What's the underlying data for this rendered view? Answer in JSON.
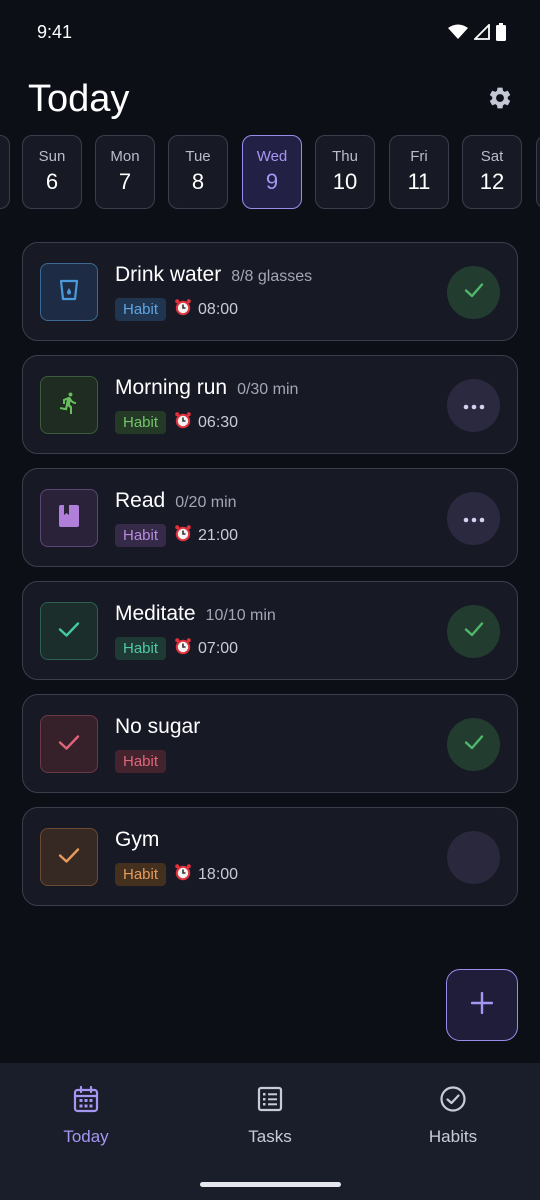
{
  "status_bar": {
    "time": "9:41"
  },
  "header": {
    "title": "Today"
  },
  "days": [
    {
      "name": "Sun",
      "num": "6"
    },
    {
      "name": "Mon",
      "num": "7"
    },
    {
      "name": "Tue",
      "num": "8"
    },
    {
      "name": "Wed",
      "num": "9"
    },
    {
      "name": "Thu",
      "num": "10"
    },
    {
      "name": "Fri",
      "num": "11"
    },
    {
      "name": "Sat",
      "num": "12"
    }
  ],
  "selected_day": "Wed",
  "habits": [
    {
      "title": "Drink water",
      "progress": "8/8 glasses",
      "badge": "Habit",
      "time": "08:00",
      "icon": "water-glass-icon",
      "accent": "#4b9ad9",
      "status": "done"
    },
    {
      "title": "Morning run",
      "progress": "0/30 min",
      "badge": "Habit",
      "time": "06:30",
      "icon": "running-person-icon",
      "accent": "#69bd5e",
      "status": "pending"
    },
    {
      "title": "Read",
      "progress": "0/20 min",
      "badge": "Habit",
      "time": "21:00",
      "icon": "book-icon",
      "accent": "#b07fd9",
      "status": "pending"
    },
    {
      "title": "Meditate",
      "progress": "10/10 min",
      "badge": "Habit",
      "time": "07:00",
      "icon": "checkmark-icon",
      "accent": "#45c9a0",
      "status": "done"
    },
    {
      "title": "No sugar",
      "progress": "",
      "badge": "Habit",
      "time": "",
      "icon": "checkmark-icon",
      "accent": "#e0657a",
      "status": "done"
    },
    {
      "title": "Gym",
      "progress": "",
      "badge": "Habit",
      "time": "18:00",
      "icon": "checkmark-icon",
      "accent": "#e79a5c",
      "status": "empty"
    }
  ],
  "nav": {
    "today": "Today",
    "tasks": "Tasks",
    "habits": "Habits"
  },
  "colors": {
    "accent": "#a597f1",
    "done": "#4fb86a",
    "background": "#0d0f17",
    "card": "#171925"
  }
}
